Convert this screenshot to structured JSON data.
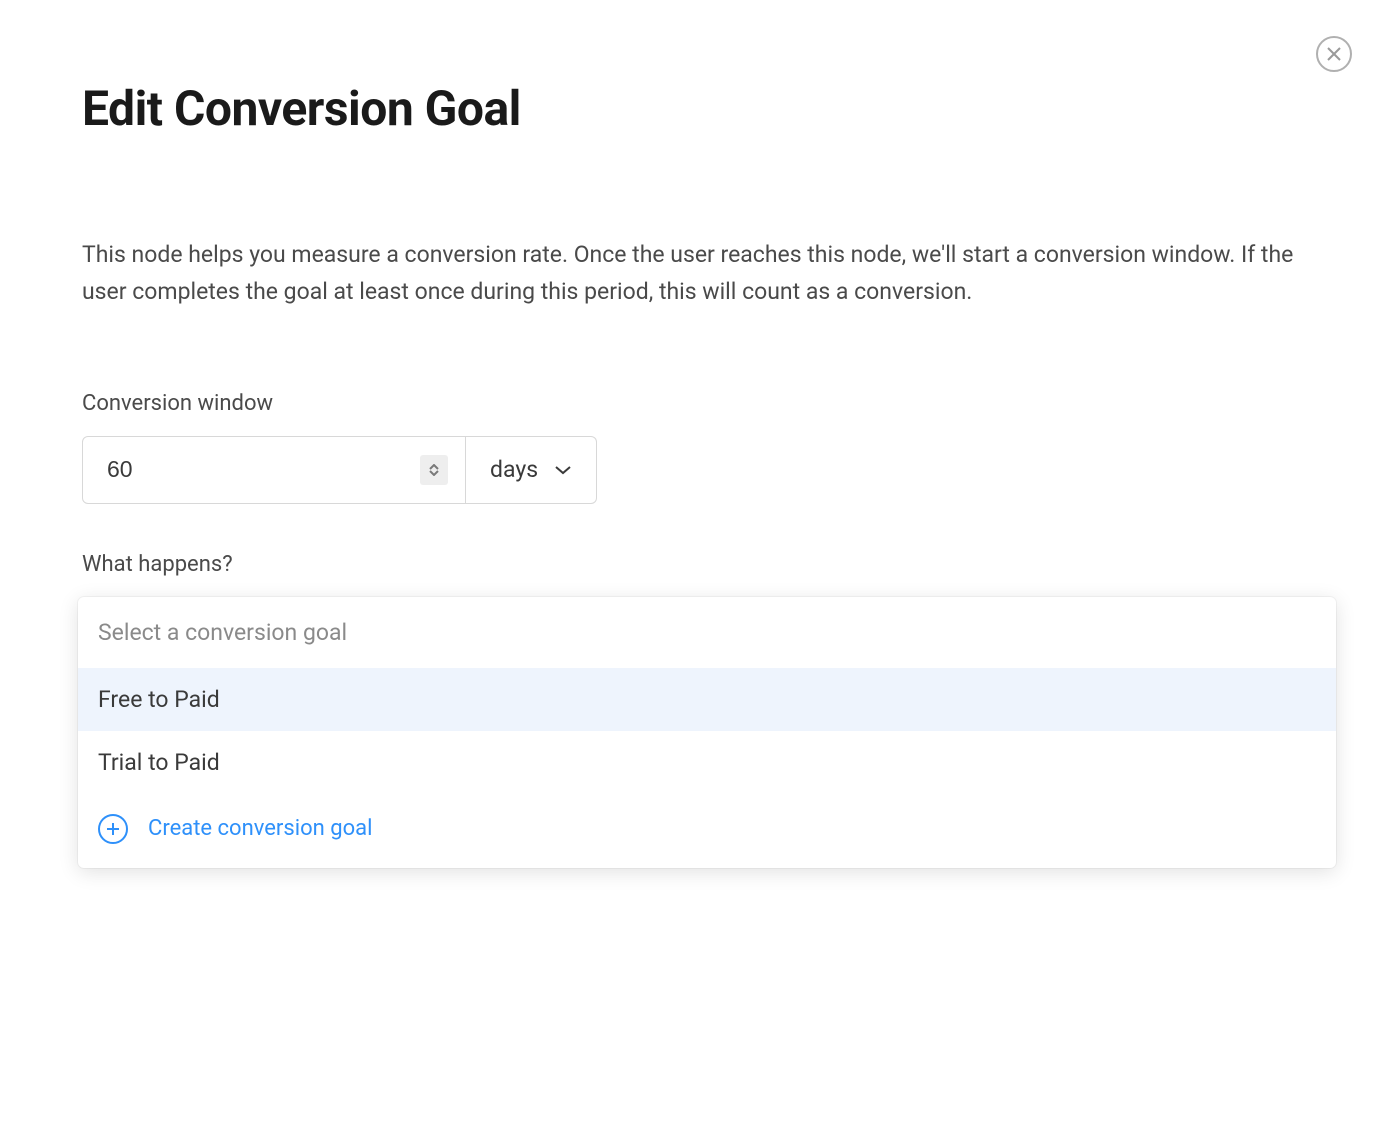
{
  "modal": {
    "title": "Edit Conversion Goal",
    "description": "This node helps you measure a conversion rate. Once the user reaches this node, we'll start a conversion window. If the user completes the goal at least once during this period, this will count as a conversion."
  },
  "conversion_window": {
    "label": "Conversion window",
    "value": "60",
    "unit": "days"
  },
  "goal_section": {
    "label": "What happens?"
  },
  "dropdown": {
    "placeholder": "Select a conversion goal",
    "options": [
      "Free to Paid",
      "Trial to Paid"
    ],
    "create_label": "Create conversion goal"
  }
}
